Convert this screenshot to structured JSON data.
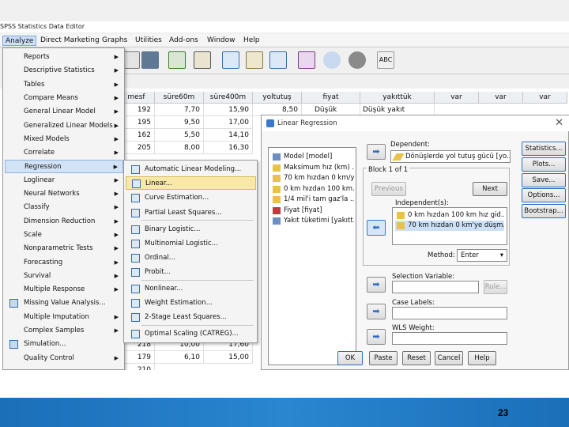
{
  "app": {
    "title": "SPSS Statistics Data Editor"
  },
  "menubar": [
    "Analyze",
    "Direct Marketing",
    "Graphs",
    "Utilities",
    "Add-ons",
    "Window",
    "Help"
  ],
  "analyze_menu": [
    {
      "label": "Reports",
      "arrow": true
    },
    {
      "label": "Descriptive Statistics",
      "arrow": true
    },
    {
      "label": "Tables",
      "arrow": true
    },
    {
      "label": "Compare Means",
      "arrow": true
    },
    {
      "label": "General Linear Model",
      "arrow": true
    },
    {
      "label": "Generalized Linear Models",
      "arrow": true
    },
    {
      "label": "Mixed Models",
      "arrow": true
    },
    {
      "label": "Correlate",
      "arrow": true
    },
    {
      "label": "Regression",
      "arrow": true
    },
    {
      "label": "Loglinear",
      "arrow": true
    },
    {
      "label": "Neural Networks",
      "arrow": true
    },
    {
      "label": "Classify",
      "arrow": true
    },
    {
      "label": "Dimension Reduction",
      "arrow": true
    },
    {
      "label": "Scale",
      "arrow": true
    },
    {
      "label": "Nonparametric Tests",
      "arrow": true
    },
    {
      "label": "Forecasting",
      "arrow": true
    },
    {
      "label": "Survival",
      "arrow": true
    },
    {
      "label": "Multiple Response",
      "arrow": true
    },
    {
      "label": "Missing Value Analysis...",
      "arrow": false
    },
    {
      "label": "Multiple Imputation",
      "arrow": true
    },
    {
      "label": "Complex Samples",
      "arrow": true
    },
    {
      "label": "Simulation...",
      "arrow": false
    },
    {
      "label": "Quality Control",
      "arrow": true
    }
  ],
  "regression_menu": [
    "Automatic Linear Modeling...",
    "Linear...",
    "Curve Estimation...",
    "Partial Least Squares...",
    "Binary Logistic...",
    "Multinomial Logistic...",
    "Ordinal...",
    "Probit...",
    "Nonlinear...",
    "Weight Estimation...",
    "2-Stage Least Squares...",
    "Optimal Scaling (CATREG)..."
  ],
  "grid": {
    "columns": [
      "mesf",
      "süre60m",
      "süre400m",
      "yoltutuş",
      "fiyat",
      "yakıttük",
      "var",
      "var",
      "var"
    ],
    "rows": [
      [
        "192",
        "7,70",
        "15,90",
        "8,50",
        "Düşük fiyatı",
        "Düşük yakıt tüketimi"
      ],
      [
        "195",
        "9,50",
        "17,00",
        "",
        "",
        "",
        ""
      ],
      [
        "162",
        "5,50",
        "14,10",
        "",
        "",
        "",
        ""
      ],
      [
        "205",
        "8,00",
        "16,30",
        "",
        "",
        "",
        ""
      ],
      [
        "218",
        "10,00",
        "17,60",
        "",
        "",
        "",
        ""
      ],
      [
        "179",
        "6,10",
        "15,00",
        "",
        "",
        "",
        ""
      ],
      [
        "210",
        "",
        "",
        "",
        "",
        "",
        ""
      ]
    ]
  },
  "dialog": {
    "title": "Linear Regression",
    "variables": [
      "Model [model]",
      "Maksimum hız (km) ...",
      "70 km hızdan 0 km/y...",
      "0 km hızdan 100 km...",
      "1/4 mil'i tam gaz'la ...",
      "Fiyat [fiyat]",
      "Yakıt tüketimi [yakıtt..."
    ],
    "dependent_label": "Dependent:",
    "dependent_value": "Dönüşlerde yol tutuş gücü [yo...",
    "block_label": "Block 1 of 1",
    "previous_label": "Previous",
    "next_label": "Next",
    "independent_label": "Independent(s):",
    "independents": [
      "0 km hızdan 100 km hız gid...",
      "70 km hızdan 0 km'ye düşm..."
    ],
    "method_label": "Method:",
    "method_value": "Enter",
    "selection_label": "Selection Variable:",
    "rule_label": "Rule...",
    "case_labels_label": "Case Labels:",
    "wls_label": "WLS Weight:",
    "side_buttons": [
      "Statistics...",
      "Plots...",
      "Save...",
      "Options...",
      "Bootstrap..."
    ],
    "bottom_buttons": [
      "OK",
      "Paste",
      "Reset",
      "Cancel",
      "Help"
    ]
  },
  "toolbar": {
    "alt_label": "ABC"
  },
  "slide": {
    "page_number": "23"
  },
  "colors": {
    "footer": "#1a6fb8",
    "selection": "#cde0f6",
    "highlight": "#f8e9a8"
  }
}
